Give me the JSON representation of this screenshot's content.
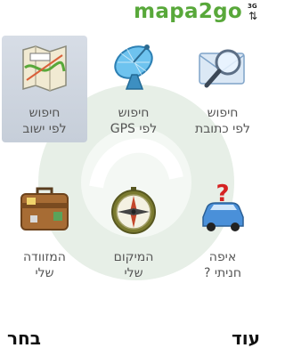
{
  "status": {
    "network": "3G",
    "brand": "mapa2go"
  },
  "menu": [
    {
      "id": "address",
      "line1": "חיפוש",
      "line2": "לפי כתובת",
      "icon": "search-magnifier-icon"
    },
    {
      "id": "gps",
      "line1": "חיפוש",
      "line2": "לפי GPS",
      "icon": "satellite-dish-icon"
    },
    {
      "id": "town",
      "line1": "חיפוש",
      "line2": "לפי ישוב",
      "icon": "folded-map-icon",
      "selected": true
    },
    {
      "id": "parking",
      "line1": "איפה",
      "line2": "חניתי ?",
      "icon": "car-question-icon"
    },
    {
      "id": "location",
      "line1": "המיקום",
      "line2": "שלי",
      "icon": "compass-icon"
    },
    {
      "id": "suitcase",
      "line1": "המזוודה",
      "line2": "שלי",
      "icon": "suitcase-icon"
    }
  ],
  "softkeys": {
    "left": "בחר",
    "right": "עוד"
  },
  "colors": {
    "brand": "#58a83a",
    "selection": "#cdd4de",
    "watermark": "#e7efe7"
  }
}
